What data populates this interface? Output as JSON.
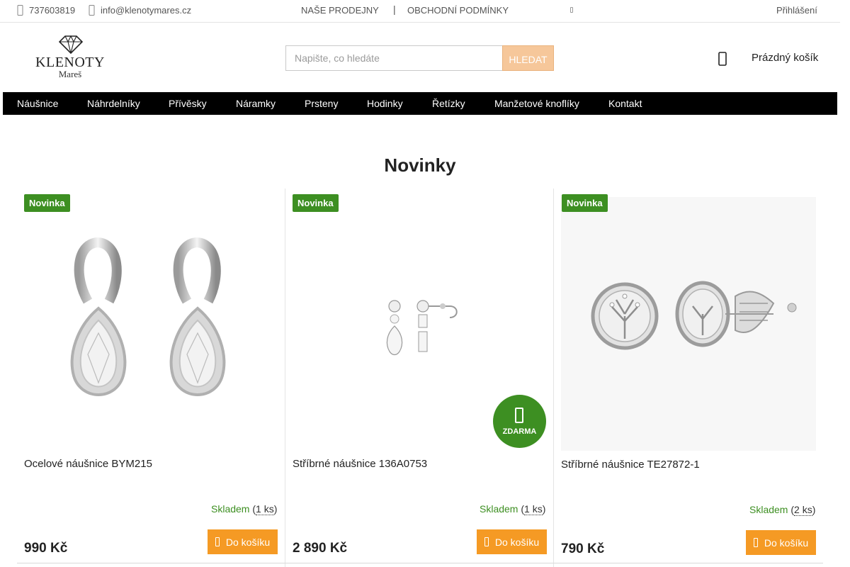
{
  "topbar": {
    "phone": "737603819",
    "email": "info@klenotymares.cz",
    "links": [
      "NAŠE PRODEJNY",
      "OBCHODNÍ PODMÍNKY"
    ],
    "separator": "|",
    "login": "Přihlášení"
  },
  "header": {
    "logo_text": "KLENOTY",
    "logo_sub": "Mareš",
    "search_placeholder": "Napište, co hledáte",
    "search_button": "HLEDAT",
    "cart_label": "Prázdný košík"
  },
  "nav": {
    "items": [
      "Náušnice",
      "Náhrdelníky",
      "Přívěsky",
      "Náramky",
      "Prsteny",
      "Hodinky",
      "Řetízky",
      "Manžetové knoflíky",
      "Kontakt"
    ]
  },
  "section": {
    "title": "Novinky"
  },
  "products": [
    {
      "badge": "Novinka",
      "title": "Ocelové náušnice BYM215",
      "stock_label": "Skladem",
      "stock_qty": "1 ks",
      "price": "990 Kč",
      "button": "Do košíku"
    },
    {
      "badge": "Novinka",
      "title": "Stříbrné náušnice 136A0753",
      "stock_label": "Skladem",
      "stock_qty": "1 ks",
      "price": "2 890 Kč",
      "button": "Do košíku"
    },
    {
      "badge": "Novinka",
      "title": "Stříbrné náušnice TE27872-1",
      "stock_label": "Skladem",
      "stock_qty": "2 ks",
      "price": "790 Kč",
      "button": "Do košíku"
    }
  ],
  "free_shipping": {
    "label": "ZDARMA",
    "icon": "truck-icon"
  },
  "colors": {
    "accent": "#f59a24",
    "badge": "#3d8f22",
    "nav": "#000000"
  }
}
